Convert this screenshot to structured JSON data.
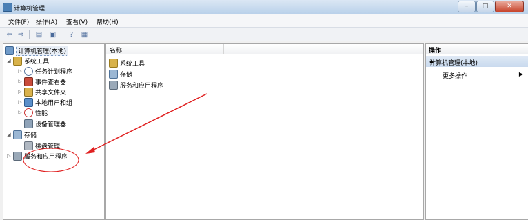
{
  "window": {
    "title": "计算机管理"
  },
  "window_buttons": {
    "minimize": "–",
    "maximize": "□",
    "close": "✕"
  },
  "menu": [
    {
      "label": "文件(F)"
    },
    {
      "label": "操作(A)"
    },
    {
      "label": "查看(V)"
    },
    {
      "label": "帮助(H)"
    }
  ],
  "toolbar": {
    "back_glyph": "⇦",
    "forward_glyph": "⇨",
    "up_glyph": "▤",
    "export_glyph": "▣",
    "help_glyph": "?",
    "show_glyph": "▦"
  },
  "tree": {
    "root": "计算机管理(本地)",
    "system_tools": "系统工具",
    "task_scheduler": "任务计划程序",
    "event_viewer": "事件查看器",
    "shared_folders": "共享文件夹",
    "local_users": "本地用户和组",
    "performance": "性能",
    "device_manager": "设备管理器",
    "storage": "存储",
    "disk_management": "磁盘管理",
    "services": "服务和应用程序"
  },
  "main": {
    "column_name": "名称",
    "items": [
      {
        "label": "系统工具"
      },
      {
        "label": "存储"
      },
      {
        "label": "服务和应用程序"
      }
    ]
  },
  "actions": {
    "header": "操作",
    "section": "计算机管理(本地)",
    "section_arrow": "▲",
    "more": "更多操作",
    "more_arrow": "▶"
  },
  "annotation_color": "#e02020"
}
